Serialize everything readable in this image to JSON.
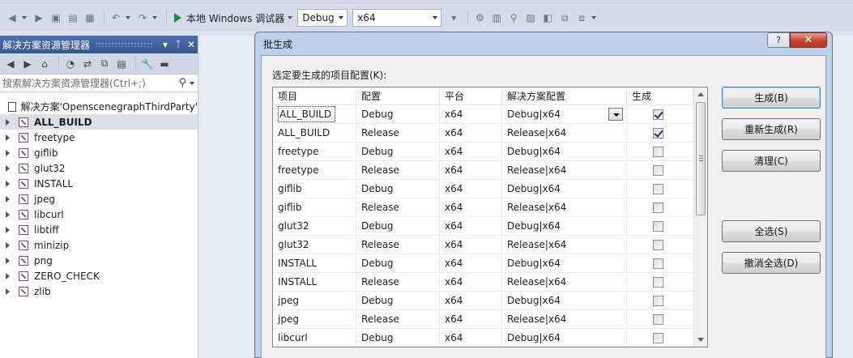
{
  "toolbar": {
    "start_label": "本地 Windows 调试器",
    "config_value": "Debug",
    "platform_value": "x64"
  },
  "explorer": {
    "title": "解决方案资源管理器",
    "pin_glyph": "▼  ᛏ  ✕",
    "search_placeholder": "搜索解决方案资源管理器(Ctrl+;)",
    "solution_label": "解决方案'OpenscenegraphThirdParty'",
    "items": [
      {
        "label": "ALL_BUILD",
        "selected": true
      },
      {
        "label": "freetype"
      },
      {
        "label": "giflib"
      },
      {
        "label": "glut32"
      },
      {
        "label": "INSTALL"
      },
      {
        "label": "jpeg"
      },
      {
        "label": "libcurl"
      },
      {
        "label": "libtiff"
      },
      {
        "label": "minizip"
      },
      {
        "label": "png"
      },
      {
        "label": "ZERO_CHECK"
      },
      {
        "label": "zlib"
      }
    ]
  },
  "dialog": {
    "title": "批生成",
    "help_label": "?",
    "close_label": "✕",
    "prompt": "选定要生成的项目配置(K):",
    "columns": [
      "项目",
      "配置",
      "平台",
      "解决方案配置",
      "生成"
    ],
    "rows": [
      {
        "project": "ALL_BUILD",
        "config": "Debug",
        "platform": "x64",
        "solution_config": "Debug|x64",
        "build": true
      },
      {
        "project": "ALL_BUILD",
        "config": "Release",
        "platform": "x64",
        "solution_config": "Release|x64",
        "build": true
      },
      {
        "project": "freetype",
        "config": "Debug",
        "platform": "x64",
        "solution_config": "Debug|x64",
        "build": false
      },
      {
        "project": "freetype",
        "config": "Release",
        "platform": "x64",
        "solution_config": "Release|x64",
        "build": false
      },
      {
        "project": "giflib",
        "config": "Debug",
        "platform": "x64",
        "solution_config": "Debug|x64",
        "build": false
      },
      {
        "project": "giflib",
        "config": "Release",
        "platform": "x64",
        "solution_config": "Release|x64",
        "build": false
      },
      {
        "project": "glut32",
        "config": "Debug",
        "platform": "x64",
        "solution_config": "Debug|x64",
        "build": false
      },
      {
        "project": "glut32",
        "config": "Release",
        "platform": "x64",
        "solution_config": "Release|x64",
        "build": false
      },
      {
        "project": "INSTALL",
        "config": "Debug",
        "platform": "x64",
        "solution_config": "Debug|x64",
        "build": false
      },
      {
        "project": "INSTALL",
        "config": "Release",
        "platform": "x64",
        "solution_config": "Release|x64",
        "build": false
      },
      {
        "project": "jpeg",
        "config": "Debug",
        "platform": "x64",
        "solution_config": "Debug|x64",
        "build": false
      },
      {
        "project": "jpeg",
        "config": "Release",
        "platform": "x64",
        "solution_config": "Release|x64",
        "build": false
      },
      {
        "project": "libcurl",
        "config": "Debug",
        "platform": "x64",
        "solution_config": "Debug|x64",
        "build": false
      }
    ],
    "buttons": {
      "build": "生成(B)",
      "rebuild": "重新生成(R)",
      "clean": "清理(C)",
      "select_all": "全选(S)",
      "deselect_all": "撤消全选(D)"
    }
  }
}
